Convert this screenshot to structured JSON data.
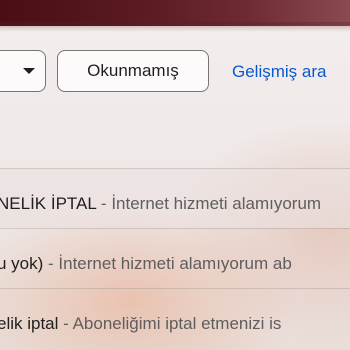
{
  "filters": {
    "unread_chip": "Okunmamış",
    "advanced_search": "Gelişmiş ara"
  },
  "emails": [
    {
      "subject": "NELİK İPTAL",
      "separator": " - ",
      "snippet": "İnternet hizmeti alamıyorum"
    },
    {
      "subject": "u yok)",
      "separator": " - ",
      "snippet": "İnternet hizmeti alamıyorum ab"
    },
    {
      "subject": "elik iptal",
      "separator": " - ",
      "snippet": "Aboneliğimi iptal etmenizi is"
    }
  ],
  "colors": {
    "link": "#0b57d0",
    "theme_band": "#4a0e14"
  }
}
